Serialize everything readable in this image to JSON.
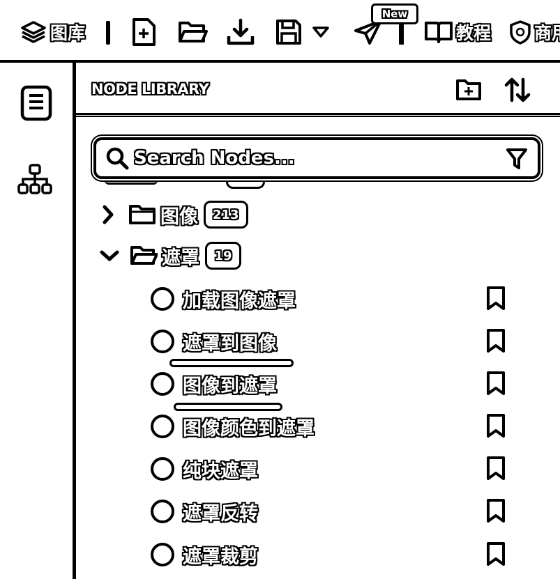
{
  "toolbar": {
    "library_label": "图库",
    "new_badge": "New",
    "tutorial_label": "教程",
    "commercial_label": "商用"
  },
  "panel": {
    "title": "NODE LIBRARY"
  },
  "search": {
    "placeholder": "Search Nodes..."
  },
  "folders": [
    {
      "name": "图像",
      "count": "213",
      "expanded": false
    },
    {
      "name": "遮罩",
      "count": "19",
      "expanded": true
    }
  ],
  "nodes": [
    {
      "label": "加载图像遮罩"
    },
    {
      "label": "遮罩到图像"
    },
    {
      "label": "图像到遮罩"
    },
    {
      "label": "图像颜色到遮罩"
    },
    {
      "label": "纯块遮罩"
    },
    {
      "label": "遮罩反转"
    },
    {
      "label": "遮罩裁剪"
    }
  ]
}
